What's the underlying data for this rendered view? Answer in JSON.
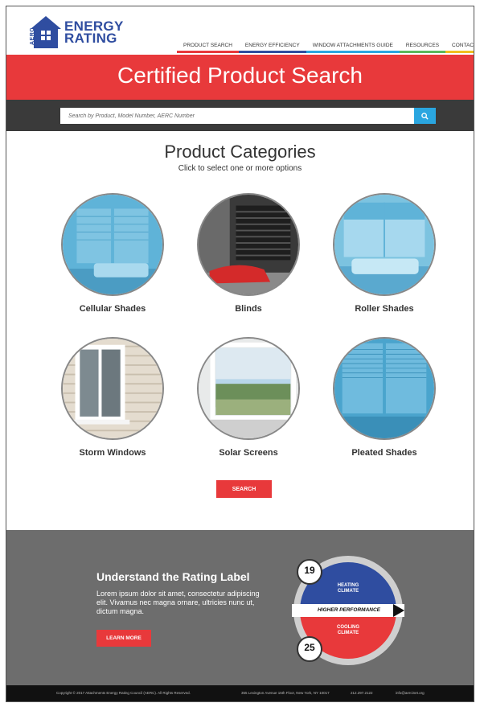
{
  "logo": {
    "side_text": "AERC",
    "line1": "ENERGY",
    "line2": "RATING"
  },
  "nav": [
    {
      "label": "PRODUCT SEARCH",
      "underline": "#e8393b"
    },
    {
      "label": "ENERGY EFFICIENCY",
      "underline": "#2f4da0"
    },
    {
      "label": "WINDOW ATTACHMENTS GUIDE",
      "underline": "#2aa6e0"
    },
    {
      "label": "RESOURCES",
      "underline": "#5cb85c"
    },
    {
      "label": "CONTACT",
      "underline": "#f0c020"
    }
  ],
  "hero": {
    "title": "Certified Product Search"
  },
  "search": {
    "placeholder": "Search by Product, Model Number, AERC Number",
    "button_icon": "search-icon"
  },
  "categories": {
    "title": "Product Categories",
    "subtitle": "Click to select one or more options",
    "items": [
      {
        "label": "Cellular Shades"
      },
      {
        "label": "Blinds"
      },
      {
        "label": "Roller Shades"
      },
      {
        "label": "Storm Windows"
      },
      {
        "label": "Solar Screens"
      },
      {
        "label": "Pleated Shades"
      }
    ],
    "search_label": "SEARCH"
  },
  "rating": {
    "heading": "Understand the Rating Label",
    "body": "Lorem ipsum dolor sit amet, consectetur adipiscing elit. Vivamus nec magna ornare, ultricies nunc ut, dictum magna.",
    "button": "LEARN MORE",
    "graphic": {
      "heating_value": "19",
      "cooling_value": "25",
      "heating_label": "HEATING CLIMATE",
      "cooling_label": "COOLING CLIMATE",
      "band_label": "HIGHER PERFORMANCE"
    }
  },
  "footer": {
    "copyright": "Copyright © 2017 Attachments Energy Rating Council (AERC). All Rights Reserved.",
    "address": "355 Lexington Avenue 15th Floor, New York, NY 10017",
    "phone": "212.297.2122",
    "email": "info@aercinet.org"
  },
  "colors": {
    "accent": "#e8393b",
    "brand": "#2f4da0",
    "dark": "#3a3a3a",
    "button_blue": "#2aa6e0"
  }
}
